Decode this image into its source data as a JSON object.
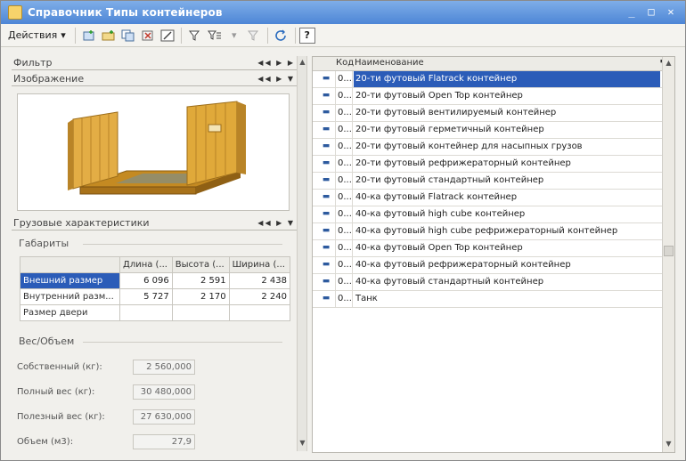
{
  "window": {
    "title": "Справочник Типы контейнеров",
    "controls": [
      "_",
      "□",
      "✕"
    ]
  },
  "toolbar": {
    "actions_label": "Действия",
    "help_label": "?"
  },
  "left": {
    "filter_label": "Фильтр",
    "image_label": "Изображение",
    "cargo_label": "Грузовые характеристики",
    "dims_label": "Габариты",
    "weight_label": "Вес/Объем",
    "dims_table": {
      "headers": [
        "",
        "Длина (...",
        "Высота (...",
        "Ширина (..."
      ],
      "rows": [
        [
          "Внешний размер",
          "6 096",
          "2 591",
          "2 438"
        ],
        [
          "Внутренний разм...",
          "5 727",
          "2 170",
          "2 240"
        ],
        [
          "Размер двери",
          "",
          "",
          ""
        ]
      ]
    },
    "fields": [
      {
        "label": "Собственный (кг):",
        "value": "2 560,000"
      },
      {
        "label": "Полный вес (кг):",
        "value": "30 480,000"
      },
      {
        "label": "Полезный вес (кг):",
        "value": "27 630,000"
      },
      {
        "label": "Объем (м3):",
        "value": "27,9"
      }
    ]
  },
  "list": {
    "header_code": "Код",
    "header_name": "Наименование",
    "rows": [
      {
        "code": "0...",
        "name": "20-ти футовый Flatrack контейнер"
      },
      {
        "code": "0...",
        "name": "20-ти футовый Open Top контейнер"
      },
      {
        "code": "0...",
        "name": "20-ти футовый вентилируемый контейнер"
      },
      {
        "code": "0...",
        "name": "20-ти футовый герметичный контейнер"
      },
      {
        "code": "0...",
        "name": "20-ти футовый контейнер для насыпных грузов"
      },
      {
        "code": "0...",
        "name": "20-ти футовый рефрижераторный контейнер"
      },
      {
        "code": "0...",
        "name": "20-ти футовый стандартный контейнер"
      },
      {
        "code": "0...",
        "name": "40-ка футовый Flatrack контейнер"
      },
      {
        "code": "0...",
        "name": "40-ка футовый high cube контейнер"
      },
      {
        "code": "0...",
        "name": "40-ка футовый high cube рефрижераторный контейнер"
      },
      {
        "code": "0...",
        "name": "40-ка футовый Open Top контейнер"
      },
      {
        "code": "0...",
        "name": "40-ка футовый рефрижераторный контейнер"
      },
      {
        "code": "0...",
        "name": "40-ка футовый стандартный контейнер"
      },
      {
        "code": "0...",
        "name": "Танк"
      }
    ]
  },
  "colors": {
    "titlebar": "#4d86d6",
    "selection": "#2b5cb8",
    "container": "#e0a93a"
  }
}
